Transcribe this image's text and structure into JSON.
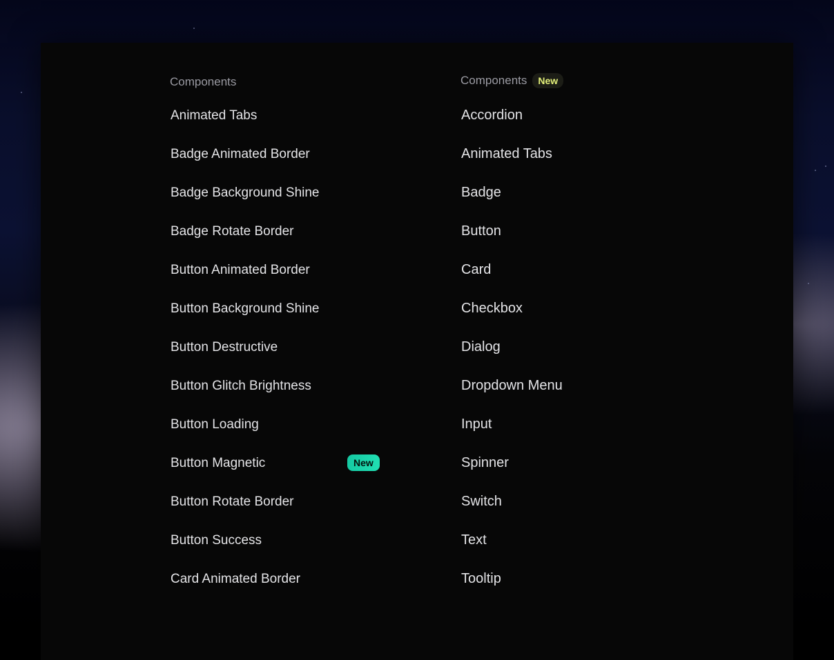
{
  "left_column": {
    "heading": "Components",
    "items": [
      {
        "label": "Animated Tabs"
      },
      {
        "label": "Badge Animated Border"
      },
      {
        "label": "Badge Background Shine"
      },
      {
        "label": "Badge Rotate Border"
      },
      {
        "label": "Button Animated Border"
      },
      {
        "label": "Button Background Shine"
      },
      {
        "label": "Button Destructive"
      },
      {
        "label": "Button Glitch Brightness"
      },
      {
        "label": "Button Loading"
      },
      {
        "label": "Button Magnetic",
        "badge": "New"
      },
      {
        "label": "Button Rotate Border"
      },
      {
        "label": "Button Success"
      },
      {
        "label": "Card Animated Border"
      }
    ]
  },
  "right_column": {
    "heading": "Components",
    "heading_badge": "New",
    "items": [
      {
        "label": "Accordion"
      },
      {
        "label": "Animated Tabs"
      },
      {
        "label": "Badge"
      },
      {
        "label": "Button"
      },
      {
        "label": "Card"
      },
      {
        "label": "Checkbox"
      },
      {
        "label": "Dialog"
      },
      {
        "label": "Dropdown Menu"
      },
      {
        "label": "Input"
      },
      {
        "label": "Spinner"
      },
      {
        "label": "Switch"
      },
      {
        "label": "Text"
      },
      {
        "label": "Tooltip"
      }
    ]
  },
  "colors": {
    "panel_background": "#070707",
    "item_text": "#e4e4e7",
    "heading_text": "#9b9ba3",
    "new_badge_green": "#21dfb3",
    "new_badge_yellow_text": "#e3f07a"
  }
}
